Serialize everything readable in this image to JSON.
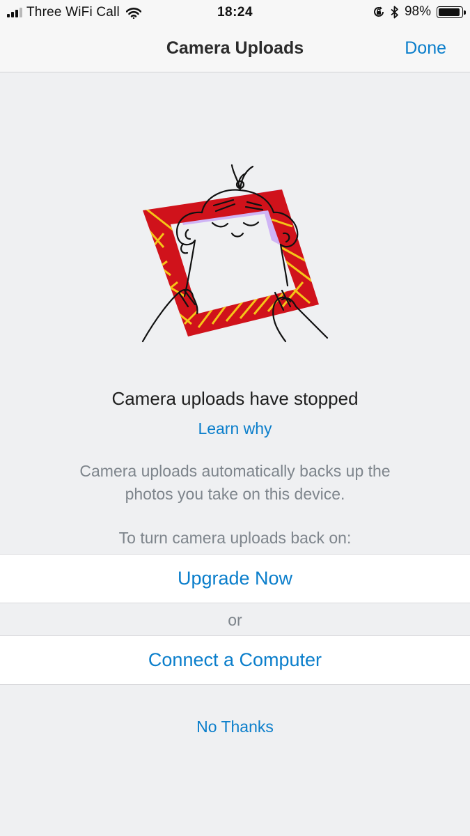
{
  "status_bar": {
    "carrier": "Three WiFi Call",
    "time": "18:24",
    "battery_percent": "98%",
    "battery_level": 0.98,
    "signal_bars_filled": 3,
    "icons": [
      "signal-icon",
      "wifi-icon",
      "rotation-lock-icon",
      "bluetooth-icon",
      "battery-icon"
    ]
  },
  "nav": {
    "title": "Camera Uploads",
    "done_label": "Done"
  },
  "content": {
    "headline": "Camera uploads have stopped",
    "learn_why": "Learn why",
    "description": "Camera uploads automatically backs up the photos you take on this device.",
    "instruction": "To turn camera uploads back on:",
    "upgrade_label": "Upgrade Now",
    "or_label": "or",
    "connect_label": "Connect a Computer",
    "no_thanks_label": "No Thanks"
  },
  "colors": {
    "accent": "#0a7ecb",
    "background": "#eff0f2",
    "frame_red": "#d0121b",
    "frame_yellow": "#f5c518",
    "frame_lavender": "#cfb4f5"
  }
}
